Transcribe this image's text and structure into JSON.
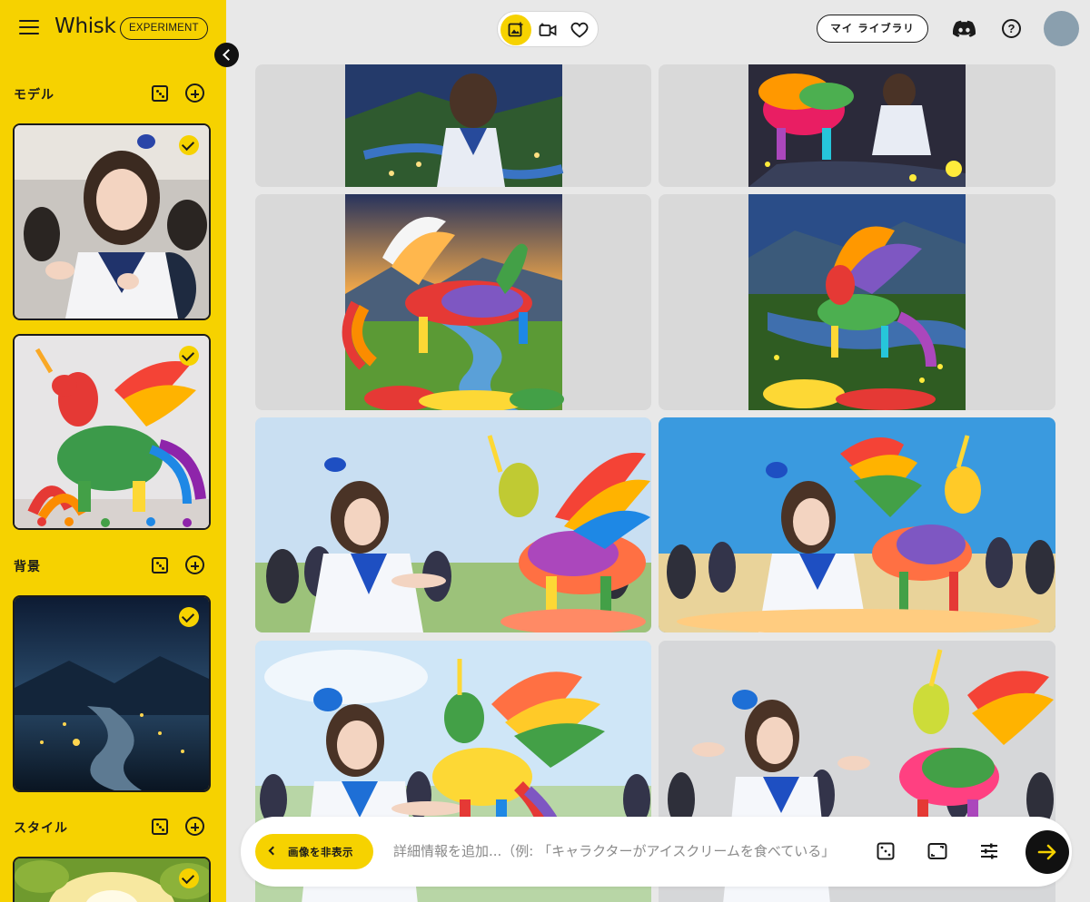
{
  "app": {
    "brand": "Whisk",
    "badge": "EXPERIMENT"
  },
  "sidebar": {
    "sections": [
      {
        "title": "モデル",
        "cards": 2
      },
      {
        "title": "背景",
        "cards": 1
      },
      {
        "title": "スタイル",
        "cards": 1
      }
    ]
  },
  "header": {
    "library_label": "マイ ライブラリ",
    "help_glyph": "?"
  },
  "prompt": {
    "hide_images_label": "画像を非表示",
    "placeholder": "詳細情報を追加...（例: 「キャラクターがアイスクリームを食べている」"
  },
  "colors": {
    "accent": "#f6d200",
    "dark": "#1b1b1b"
  }
}
